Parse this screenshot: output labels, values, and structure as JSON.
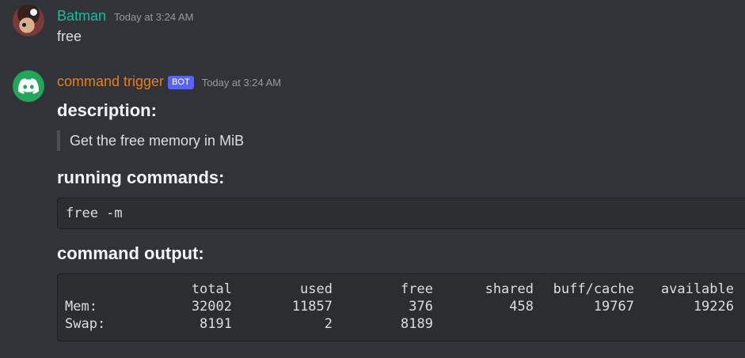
{
  "messages": [
    {
      "username": "Batman",
      "timestamp": "Today at 3:24 AM",
      "text": "free"
    },
    {
      "username": "command trigger",
      "badge": "BOT",
      "timestamp": "Today at 3:24 AM",
      "description_heading": "description:",
      "description": "Get the free memory in MiB",
      "commands_heading": "running commands:",
      "command": "free -m",
      "output_heading": "command output:",
      "output": {
        "headers": [
          "",
          "total",
          "used",
          "free",
          "shared",
          "buff/cache",
          "available"
        ],
        "rows": [
          [
            "Mem:",
            "32002",
            "11857",
            "376",
            "458",
            "19767",
            "19226"
          ],
          [
            "Swap:",
            "8191",
            "2",
            "8189",
            "",
            "",
            ""
          ]
        ]
      }
    }
  ],
  "colors": {
    "background": "#313338",
    "user_name": "#1abc9c",
    "bot_name": "#e67e22",
    "bot_badge": "#5865f2",
    "bot_avatar": "#23a55a",
    "codeblock": "#2b2d31"
  },
  "icons": {
    "bot_avatar": "discord-logo-icon"
  }
}
